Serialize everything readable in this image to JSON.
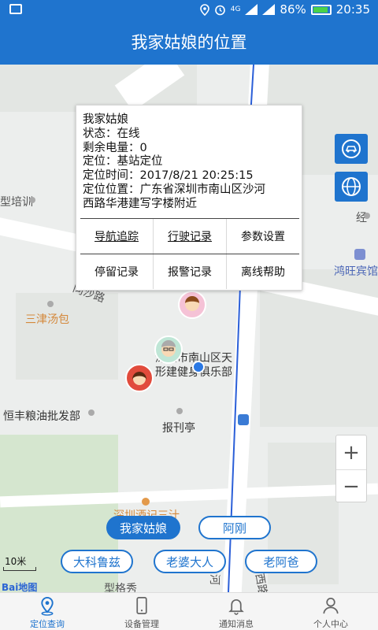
{
  "status_bar": {
    "battery": "86%",
    "time": "20:35",
    "network": "4G"
  },
  "title": "我家姑娘的位置",
  "popup": {
    "name": "我家姑娘",
    "status": "状态：在线",
    "battery": "剩余电量：0",
    "positioning": "定位：基站定位",
    "time": "定位时间：2017/8/21 20:25:15",
    "location_line1": "定位位置：广东省深圳市南山区沙河",
    "location_line2": "西路华港建写字楼附近",
    "buttons_row1": [
      "导航追踪",
      "行驶记录",
      "参数设置"
    ],
    "buttons_row2": [
      "停留记录",
      "报警记录",
      "离线帮助"
    ]
  },
  "map_labels": {
    "training": "型培训",
    "jing": "经",
    "hotel": "鸿旺宾馆",
    "tangbao": "三津汤包",
    "road_tongsha": "同沙路",
    "club_line1": "深圳市南山区天",
    "club_line2": "形建健身俱乐部",
    "grain": "恒丰粮油批发部",
    "newspaper": "报刊亭",
    "shenzhen_store": "深圳酒记三汁",
    "he": "河",
    "xilu": "西路",
    "xingge": "型格秀"
  },
  "devices": [
    "我家姑娘",
    "阿刚",
    "大科鲁兹",
    "老婆大人",
    "老阿爸"
  ],
  "active_device": "我家姑娘",
  "scale": "10米",
  "baidu_logo": "Bai地图",
  "tabs": [
    "定位查询",
    "设备管理",
    "通知消息",
    "个人中心"
  ],
  "active_tab": "定位查询",
  "colors": {
    "primary": "#1f74ce",
    "accent_orange": "#d4883b"
  }
}
